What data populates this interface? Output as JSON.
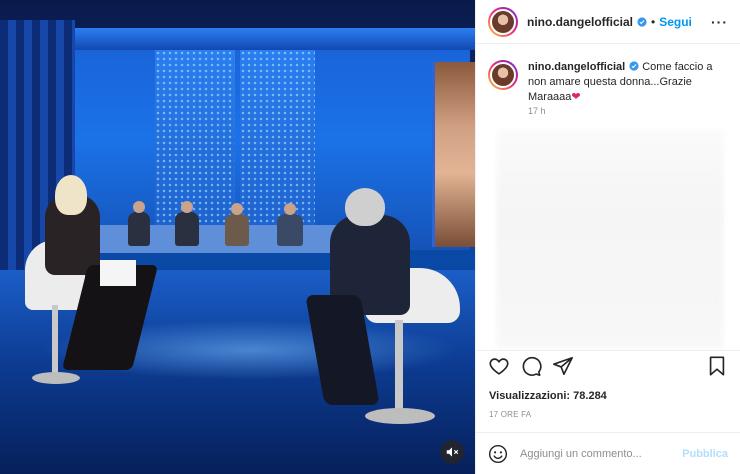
{
  "post": {
    "username": "nino.dangelofficial",
    "follow_label": "Segui",
    "separator": "•",
    "more_label": "···"
  },
  "caption": {
    "username": "nino.dangelofficial",
    "text": "Come faccio a non amare questa donna...Grazie Maraaaa",
    "emoji": "❤",
    "time_ago": "17 h"
  },
  "actions": {
    "like_icon": "heart-icon",
    "comment_icon": "comment-icon",
    "share_icon": "share-icon",
    "save_icon": "bookmark-icon"
  },
  "stats": {
    "views_label": "Visualizzazioni:",
    "views_count": "78.284",
    "date": "17 ORE FA"
  },
  "comment": {
    "placeholder": "Aggiungi un commento...",
    "publish_label": "Pubblica"
  },
  "colors": {
    "accent": "#0095f6",
    "publish_disabled": "#b2dffc",
    "verified": "#3897f0"
  }
}
